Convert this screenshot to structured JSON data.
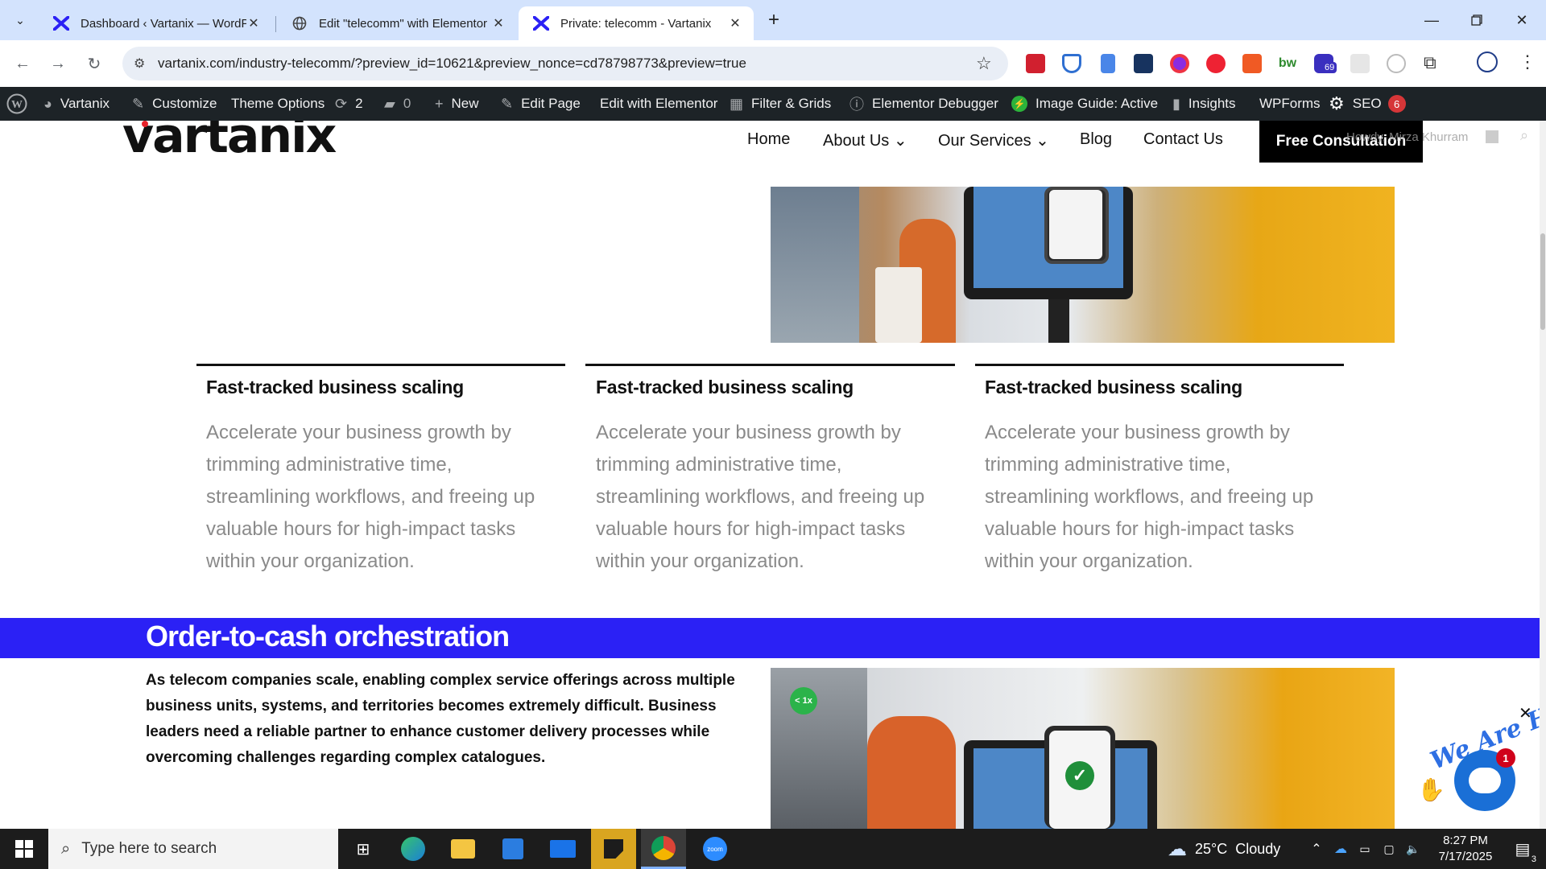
{
  "browser": {
    "tabs": [
      {
        "title": "Dashboard ‹ Vartanix — WordPress",
        "active": false
      },
      {
        "title": "Edit \"telecomm\" with Elementor",
        "active": false
      },
      {
        "title": "Private: telecomm - Vartanix",
        "active": true
      }
    ],
    "url": "vartanix.com/industry-telecomm/?preview_id=10621&preview_nonce=cd78798773&preview=true",
    "extension_badge": "69"
  },
  "adminbar": {
    "site": "Vartanix",
    "customize": "Customize",
    "theme_options": "Theme Options",
    "updates": "2",
    "comments": "0",
    "new": "New",
    "edit_page": "Edit Page",
    "edit_elementor": "Edit with Elementor",
    "filter_grids": "Filter & Grids",
    "debugger": "Elementor Debugger",
    "image_guide": "Image Guide: Active",
    "insights": "Insights",
    "wpforms": "WPForms",
    "seo": "SEO",
    "seo_count": "6",
    "howdy": "Howdy, Mirza Khurram"
  },
  "site": {
    "logo": "vartanix",
    "nav": {
      "home": "Home",
      "about": "About Us",
      "services": "Our Services",
      "blog": "Blog",
      "contact": "Contact Us",
      "cta": "Free Consultation"
    },
    "cards": [
      {
        "title": "Fast-tracked business scaling",
        "text": "Accelerate your business growth by trimming administrative time, streamlining workflows, and freeing up valuable hours for high-impact tasks within your organization."
      },
      {
        "title": "Fast-tracked business scaling",
        "text": "Accelerate your business growth by trimming administrative time, streamlining workflows, and freeing up valuable hours for high-impact tasks within your organization."
      },
      {
        "title": "Fast-tracked business scaling",
        "text": "Accelerate your business growth by trimming administrative time, streamlining workflows, and freeing up valuable hours for high-impact tasks within your organization."
      }
    ],
    "section_heading": "Order-to-cash orchestration",
    "section_text": "As telecom companies scale, enabling complex service offerings across multiple business units, systems, and territories becomes extremely difficult. Business leaders need a reliable partner to enhance customer delivery processes while overcoming challenges regarding complex catalogues.",
    "image_badge": "< 1x",
    "chat_tagline": "We Are Here!",
    "chat_badge": "1",
    "accent_color": "#2b21f5"
  },
  "taskbar": {
    "search_placeholder": "Type here to search",
    "weather": "25°C  Cloudy",
    "time": "8:27 PM",
    "date": "7/17/2025",
    "notifications": "3"
  }
}
